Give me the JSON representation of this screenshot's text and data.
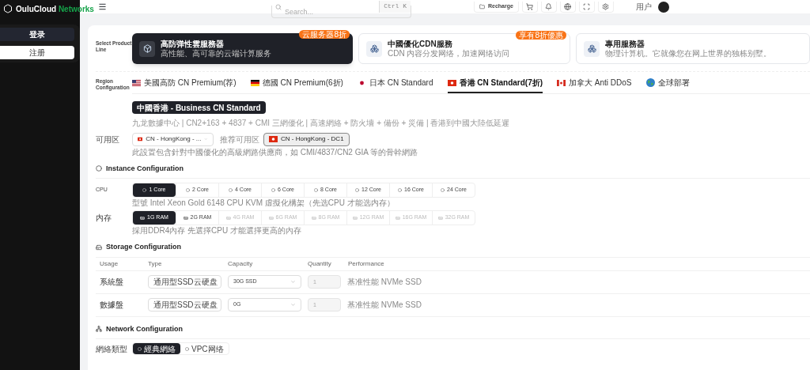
{
  "brand": {
    "name": "OuluCloud",
    "suffix": "Networks"
  },
  "sidebar": {
    "buttons": [
      {
        "label": "登录",
        "kind": "primary"
      },
      {
        "label": "注册",
        "kind": "secondary"
      }
    ]
  },
  "header": {
    "search": {
      "placeholder": "Search...",
      "shortcut": "Ctrl K"
    },
    "recharge": "Recharge",
    "user": "用户"
  },
  "product_line": {
    "label": "Select Product Line",
    "items": [
      {
        "title": "高防弹性雲服務器",
        "subtitle": "高性能、高可靠的云端计算服务",
        "badge": "云服务器8折",
        "selected": true
      },
      {
        "title": "中國優化CDN服務",
        "subtitle": "CDN 内容分发网络，加速网络访问",
        "badge": "享有8折優惠",
        "selected": false
      },
      {
        "title": "專用服務器",
        "subtitle": "物理计算机。它就像您在网上世界的独栋别墅。",
        "selected": false
      }
    ]
  },
  "region": {
    "label": "Region Configuration",
    "tabs": [
      {
        "label": "美國高防 CN Premium(荐)",
        "kind": "us",
        "selected": false
      },
      {
        "label": "德國 CN Premium(6折)",
        "kind": "de",
        "selected": false
      },
      {
        "label": "日本 CN Standard",
        "kind": "jp",
        "selected": false
      },
      {
        "label": "香港 CN Standard(7折)",
        "kind": "hk",
        "selected": true
      },
      {
        "label": "加拿大 Anti DDoS",
        "kind": "ca",
        "selected": false
      },
      {
        "label": "全球部署",
        "kind": "globe",
        "selected": false
      }
    ],
    "plan": "中國香港 - Business CN Standard",
    "description": "九龙數據中心 | CN2+163 + 4837 + CMI 三網優化 | 高速網絡 + 防火墻 + 備份 + 災備 | 香港到中國大陸低延遲",
    "zone_label": "可用区",
    "zone_value": "CN - HongKong - ...",
    "recommended_label": "推荐可用区",
    "recommended": "CN - HongKong - DC1",
    "zone_note": "此設置包含針對中國優化的高級網路供應商，如 CMI/4837/CN2 GIA 等的骨幹網路"
  },
  "instance": {
    "title": "Instance Configuration",
    "cpu_label": "CPU",
    "cpu_options": [
      {
        "label": "1 Core",
        "selected": true
      },
      {
        "label": "2 Core",
        "selected": false
      },
      {
        "label": "4 Core",
        "selected": false
      },
      {
        "label": "6 Core",
        "selected": false
      },
      {
        "label": "8 Core",
        "selected": false
      },
      {
        "label": "12 Core",
        "selected": false
      },
      {
        "label": "16 Core",
        "selected": false
      },
      {
        "label": "24 Core",
        "selected": false
      }
    ],
    "cpu_note": "型號 Intel Xeon Gold 6148 CPU KVM 虛擬化構架（先选CPU 才能选内存）",
    "memory_label": "内存",
    "memory_options": [
      {
        "label": "1G RAM",
        "selected": true,
        "disabled": false
      },
      {
        "label": "2G RAM",
        "selected": false,
        "disabled": false
      },
      {
        "label": "4G RAM",
        "selected": false,
        "disabled": true
      },
      {
        "label": "6G RAM",
        "selected": false,
        "disabled": true
      },
      {
        "label": "8G RAM",
        "selected": false,
        "disabled": true
      },
      {
        "label": "12G RAM",
        "selected": false,
        "disabled": true
      },
      {
        "label": "16G RAM",
        "selected": false,
        "disabled": true
      },
      {
        "label": "32G RAM",
        "selected": false,
        "disabled": true
      }
    ],
    "memory_note": "採用DDR4內存 先選擇CPU 才能選擇更高的內存"
  },
  "storage": {
    "title": "Storage Configuration",
    "columns": [
      "Usage",
      "Type",
      "Capacity",
      "Quantity",
      "Performance"
    ],
    "rows": [
      {
        "usage": "系統盤",
        "type": "通用型SSD云硬盘",
        "capacity": "30G SSD",
        "quantity": "1",
        "performance": "基准性能 NVMe SSD"
      },
      {
        "usage": "數據盤",
        "type": "通用型SSD云硬盘",
        "capacity": "0G",
        "quantity": "1",
        "performance": "基准性能 NVMe SSD"
      }
    ]
  },
  "network": {
    "title": "Network Configuration",
    "type_label": "網絡類型",
    "options": [
      {
        "label": "經典網絡",
        "selected": true
      },
      {
        "label": "VPC网络",
        "selected": false
      }
    ]
  }
}
